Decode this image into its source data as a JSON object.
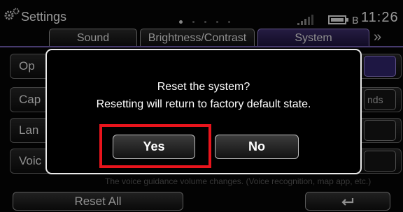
{
  "header": {
    "title": "Settings",
    "time": "11:26",
    "page_count": 5,
    "active_page": 1
  },
  "tabs": [
    {
      "label": "Sound"
    },
    {
      "label": "Brightness/Contrast"
    },
    {
      "label": "System",
      "active": true
    }
  ],
  "more_tabs": "»",
  "list": {
    "items": [
      {
        "label": "Op"
      },
      {
        "label": "Cap"
      },
      {
        "label": "Lan"
      },
      {
        "label": "Voic"
      }
    ],
    "side_values": [
      "",
      "nds",
      "",
      ""
    ],
    "hint": "The voice guidance volume changes. (Voice recognition, map app, etc.)"
  },
  "bottom": {
    "reset_all_label": "Reset All",
    "back_icon": "back-arrow-icon"
  },
  "dialog": {
    "title": "Reset the system?",
    "message": "Resetting will return to factory default state.",
    "yes_label": "Yes",
    "no_label": "No"
  },
  "colors": {
    "accent": "#6c5aa8",
    "highlight": "#e8141c",
    "dialog_border": "#eaeaea"
  }
}
